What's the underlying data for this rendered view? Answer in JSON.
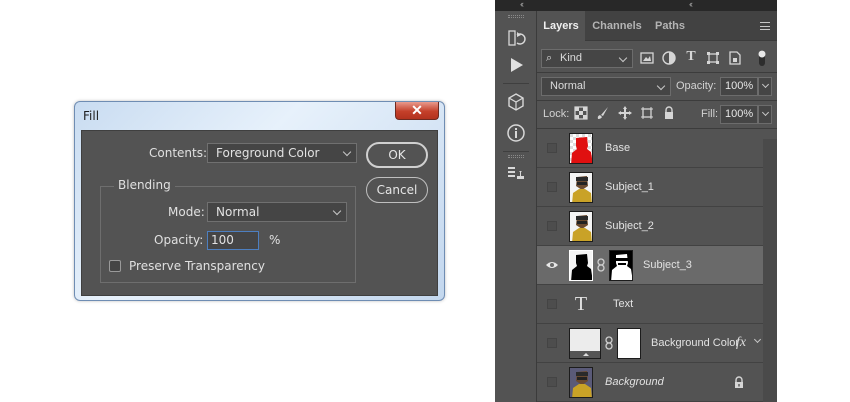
{
  "fill_dialog": {
    "title": "Fill",
    "close_glyph": "✕",
    "contents_label": "Contents:",
    "contents_value": "Foreground Color",
    "ok_label": "OK",
    "cancel_label": "Cancel",
    "blending_title": "Blending",
    "mode_label": "Mode:",
    "mode_value": "Normal",
    "opacity_label": "Opacity:",
    "opacity_value": "100",
    "opacity_unit": "%",
    "preserve_label": "Preserve Transparency",
    "preserve_checked": false
  },
  "panel": {
    "collapse_glyph": "‹‹",
    "tabs": [
      {
        "label": "Layers",
        "active": true
      },
      {
        "label": "Channels",
        "active": false
      },
      {
        "label": "Paths",
        "active": false
      }
    ],
    "filter": {
      "kind_label": "Kind",
      "search_icon": "search-icon"
    },
    "blend_mode": "Normal",
    "opacity_label": "Opacity:",
    "opacity_value": "100%",
    "lock_label": "Lock:",
    "fill_label": "Fill:",
    "fill_value": "100%",
    "layers": [
      {
        "name": "Base",
        "visible": false,
        "selected": false,
        "thumb": "red-silhouette",
        "mask": false,
        "italic": false
      },
      {
        "name": "Subject_1",
        "visible": false,
        "selected": false,
        "thumb": "portrait",
        "mask": false,
        "italic": false
      },
      {
        "name": "Subject_2",
        "visible": false,
        "selected": false,
        "thumb": "portrait",
        "mask": false,
        "italic": false
      },
      {
        "name": "Subject_3",
        "visible": true,
        "selected": true,
        "thumb": "black-silhouette",
        "mask": true,
        "italic": false
      },
      {
        "name": "Text",
        "visible": false,
        "selected": false,
        "thumb": "text",
        "mask": false,
        "italic": false
      },
      {
        "name": "Background Color",
        "visible": false,
        "selected": false,
        "thumb": "fill-layer",
        "mask": true,
        "italic": false,
        "fx": "fx"
      },
      {
        "name": "Background",
        "visible": false,
        "selected": false,
        "thumb": "portrait",
        "mask": false,
        "italic": true,
        "locked": true
      }
    ]
  },
  "colors": {
    "panel_bg": "#535353",
    "selected_row": "#6a6a6a",
    "base_red": "#e01010",
    "close_red": "#c4402a"
  }
}
